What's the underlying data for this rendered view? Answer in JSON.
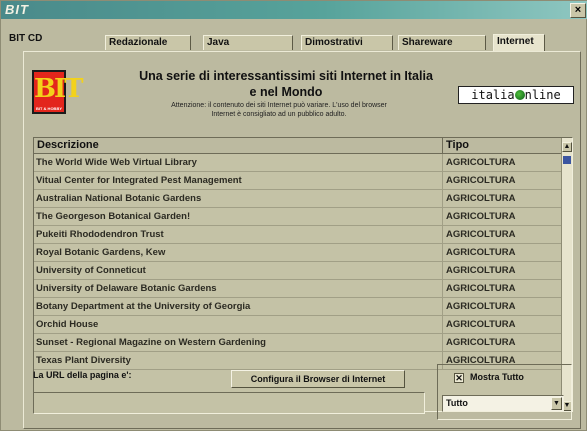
{
  "window": {
    "title": "BIT",
    "close_symbol": "×"
  },
  "tabs": [
    {
      "label": "BIT CD",
      "active": false
    },
    {
      "label": "Redazionale",
      "active": false
    },
    {
      "label": "Java",
      "active": false
    },
    {
      "label": "Dimostrativi",
      "active": false
    },
    {
      "label": "Shareware",
      "active": false
    },
    {
      "label": "Internet",
      "active": true
    }
  ],
  "header": {
    "logo_text": "BIT",
    "logo_sub": "BIT & HOBBY",
    "headline_line1": "Una serie di interessantissimi siti Internet in Italia",
    "headline_line2": "e nel Mondo",
    "warning_line1": "Attenzione: il contenuto dei siti Internet può variare. L'uso del browser",
    "warning_line2": "Internet è consigliato ad un pubblico adulto.",
    "partner_left": "italia",
    "partner_right": "nline"
  },
  "grid": {
    "col_description": "Descrizione",
    "col_type": "Tipo",
    "rows": [
      {
        "desc": "The World Wide Web Virtual Library",
        "type": "AGRICOLTURA"
      },
      {
        "desc": "Vitual Center for Integrated Pest Management",
        "type": "AGRICOLTURA"
      },
      {
        "desc": "Australian National Botanic Gardens",
        "type": "AGRICOLTURA"
      },
      {
        "desc": "The Georgeson Botanical Garden!",
        "type": "AGRICOLTURA"
      },
      {
        "desc": "Pukeiti Rhododendron Trust",
        "type": "AGRICOLTURA"
      },
      {
        "desc": "Royal Botanic Gardens, Kew",
        "type": "AGRICOLTURA"
      },
      {
        "desc": "University of Conneticut",
        "type": "AGRICOLTURA"
      },
      {
        "desc": "University of Delaware Botanic Gardens",
        "type": "AGRICOLTURA"
      },
      {
        "desc": "Botany Department at the University of Georgia",
        "type": "AGRICOLTURA"
      },
      {
        "desc": "Orchid House",
        "type": "AGRICOLTURA"
      },
      {
        "desc": " Sunset - Regional Magazine on Western Gardening",
        "type": "AGRICOLTURA"
      },
      {
        "desc": "Texas Plant Diversity",
        "type": "AGRICOLTURA"
      }
    ]
  },
  "footer": {
    "url_label": "La URL della pagina e':",
    "url_value": "",
    "config_button": "Configura il Browser di Internet",
    "show_all_label": "Mostra Tutto",
    "show_all_checked": true,
    "filter_selected": "Tutto"
  },
  "colors": {
    "titlebar": "#4a8a8a",
    "logo_bg": "#e3261c",
    "logo_text": "#f3d21a"
  }
}
